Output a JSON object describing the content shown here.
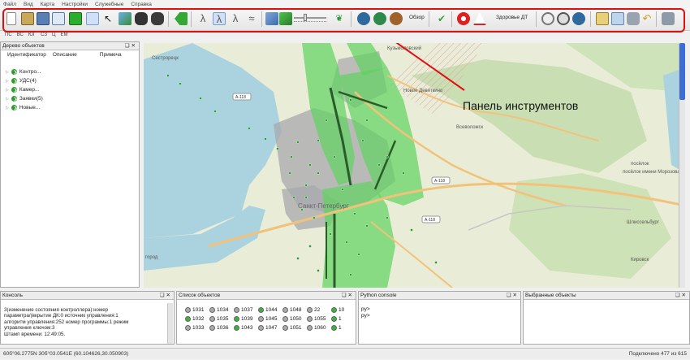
{
  "menu": [
    "Файл",
    "Вид",
    "Карта",
    "Настройки",
    "Служебные",
    "Справка"
  ],
  "toolbar": {
    "obzor_label": "Обзор",
    "health_label": "Здоровье ДТ"
  },
  "toolbar2": [
    "ПС",
    "ВС",
    "ЮГ",
    "СЗ",
    "Ц",
    "ЕМ"
  ],
  "annotation": "Панель инструментов",
  "objects_tree": {
    "title": "Дерево объектов",
    "columns": [
      "Идентификатор",
      "Описание",
      "Примеча"
    ],
    "items": [
      "Контро...",
      "УДС(4)",
      "Камер...",
      "Заявки(5)",
      "Новые..."
    ]
  },
  "map_labels": {
    "sestroretsk": "Сестрорецк",
    "kuzmolovsky": "Кузьмоловский",
    "novoe_devyatkino": "Новое Девяткино",
    "vsevolozhsk": "Всеволожск",
    "a118": "А-118",
    "spb": "Санкт-Петербург",
    "morozova": "посёлок имени Морозова",
    "shlisselburg": "Шлиссельбург",
    "kirovsk": "Кировск",
    "zhelez": "посёлок",
    "gorod": "город"
  },
  "console": {
    "title": "Консоль",
    "lines": [
      "3(изменение состояния контроллера):номер",
      "параметра/(вкрытие ДК:0 источник управления:1",
      "алгоритм управления:252 номер программы:1 режим",
      "управления ключом:3",
      "Штамп времени: 12:49:05."
    ]
  },
  "objects_list": {
    "title": "Список объектов",
    "cells": [
      {
        "id": "1031",
        "c": "#aaaaaa"
      },
      {
        "id": "1034",
        "c": "#aaaaaa"
      },
      {
        "id": "1037",
        "c": "#aaaaaa"
      },
      {
        "id": "1044",
        "c": "#3bb33b"
      },
      {
        "id": "1048",
        "c": "#aaaaaa"
      },
      {
        "id": "22",
        "c": "#aaaaaa"
      },
      {
        "id": "10",
        "c": "#3bb33b"
      },
      {
        "id": "1032",
        "c": "#3bb33b"
      },
      {
        "id": "1035",
        "c": "#aaaaaa"
      },
      {
        "id": "1039",
        "c": "#3bb33b"
      },
      {
        "id": "1045",
        "c": "#aaaaaa"
      },
      {
        "id": "1050",
        "c": "#aaaaaa"
      },
      {
        "id": "1055",
        "c": "#aaaaaa"
      },
      {
        "id": "1",
        "c": "#3bb33b"
      },
      {
        "id": "1033",
        "c": "#aaaaaa"
      },
      {
        "id": "1036",
        "c": "#aaaaaa"
      },
      {
        "id": "1043",
        "c": "#3bb33b"
      },
      {
        "id": "1047",
        "c": "#aaaaaa"
      },
      {
        "id": "1051",
        "c": "#aaaaaa"
      },
      {
        "id": "1060",
        "c": "#aaaaaa"
      },
      {
        "id": "1",
        "c": "#3bb33b"
      }
    ]
  },
  "python_console": {
    "title": "Python console",
    "lines": [
      "py>",
      "py>"
    ]
  },
  "selected": {
    "title": "Выбранные объекты"
  },
  "status": {
    "coords": "60б°06.2775N 30б°03.0541E (60.104626,30.050903)",
    "connected": "Подключено 477 из 615"
  }
}
